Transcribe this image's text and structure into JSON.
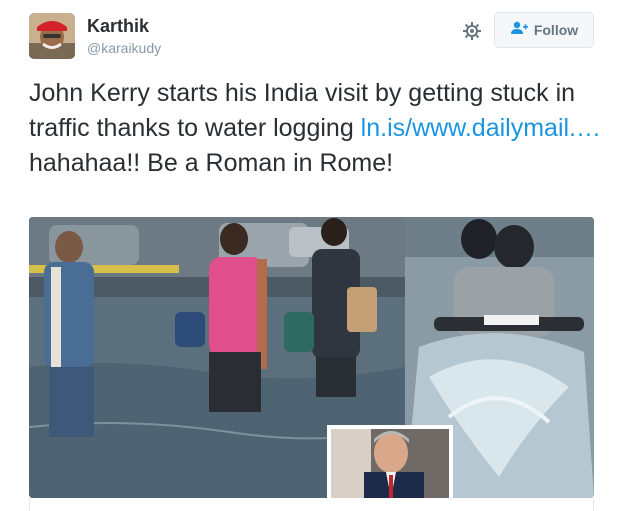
{
  "user": {
    "name": "Karthik",
    "handle": "@karaikudy"
  },
  "actions": {
    "follow_label": "Follow"
  },
  "tweet": {
    "text_before": "John Kerry starts his India visit by getting stuck in traffic thanks to water logging ",
    "link": "ln.is/www.dailymail.…",
    "text_after": " hahahaa!! Be a Roman in Rome!"
  },
  "colors": {
    "link": "#1b95e0",
    "text": "#292f33",
    "muted": "#8899a6"
  },
  "icons": [
    "gear-icon",
    "add-user-icon"
  ]
}
